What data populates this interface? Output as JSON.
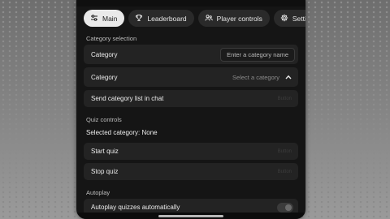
{
  "tabs": [
    {
      "label": "Main",
      "icon": "sliders-icon",
      "active": true
    },
    {
      "label": "Leaderboard",
      "icon": "trophy-icon",
      "active": false
    },
    {
      "label": "Player controls",
      "icon": "people-icon",
      "active": false
    },
    {
      "label": "Settings",
      "icon": "gear-icon",
      "active": false
    }
  ],
  "category_section": {
    "title": "Category selection",
    "category_input_label": "Category",
    "category_input_placeholder": "Enter a category name",
    "category_dropdown_label": "Category",
    "category_dropdown_value": "Select a category",
    "send_list_label": "Send category list in chat",
    "send_list_action": "Button"
  },
  "quiz_section": {
    "title": "Quiz controls",
    "selected_category_text": "Selected category: None",
    "start_label": "Start quiz",
    "start_action": "Button",
    "stop_label": "Stop quiz",
    "stop_action": "Button"
  },
  "autoplay_section": {
    "title": "Autoplay",
    "autoplay_label": "Autoplay quizzes automatically"
  },
  "colors": {
    "panel_bg": "#151515",
    "row_bg": "#232323",
    "active_tab_bg": "#e9e9e9"
  }
}
